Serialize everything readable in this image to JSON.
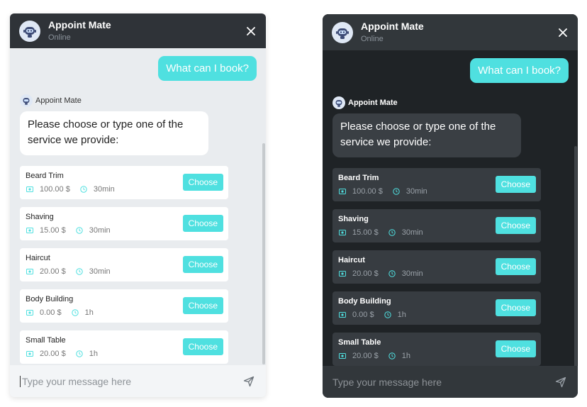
{
  "light": {
    "header": {
      "title": "Appoint Mate",
      "status": "Online",
      "close_icon": "close-icon"
    },
    "user_message": "What can I book?",
    "bot": {
      "name": "Appoint Mate",
      "message": "Please choose or type one of the service we provide:"
    },
    "services": [
      {
        "name": "Beard Trim",
        "price": "100.00 $",
        "duration": "30min",
        "button": "Choose"
      },
      {
        "name": "Shaving",
        "price": "15.00 $",
        "duration": "30min",
        "button": "Choose"
      },
      {
        "name": "Haircut",
        "price": "20.00 $",
        "duration": "30min",
        "button": "Choose"
      },
      {
        "name": "Body Building",
        "price": "0.00 $",
        "duration": "1h",
        "button": "Choose"
      },
      {
        "name": "Small Table",
        "price": "20.00 $",
        "duration": "1h",
        "button": "Choose"
      }
    ],
    "input": {
      "placeholder": "Type your message here",
      "send_icon": "send-icon"
    }
  },
  "dark": {
    "header": {
      "title": "Appoint Mate",
      "status": "Online",
      "close_icon": "close-icon"
    },
    "user_message": "What can I book?",
    "bot": {
      "name": "Appoint Mate",
      "message": "Please choose or type one of the service we provide:"
    },
    "services": [
      {
        "name": "Beard Trim",
        "price": "100.00 $",
        "duration": "30min",
        "button": "Choose"
      },
      {
        "name": "Shaving",
        "price": "15.00 $",
        "duration": "30min",
        "button": "Choose"
      },
      {
        "name": "Haircut",
        "price": "20.00 $",
        "duration": "30min",
        "button": "Choose"
      },
      {
        "name": "Body Building",
        "price": "0.00 $",
        "duration": "1h",
        "button": "Choose"
      },
      {
        "name": "Small Table",
        "price": "20.00 $",
        "duration": "1h",
        "button": "Choose"
      }
    ],
    "input": {
      "placeholder": "Type your message here",
      "send_icon": "send-icon"
    }
  },
  "colors": {
    "accent": "#4fe0e0",
    "header_bg": "#2f3338",
    "light_bg": "#e9ecef",
    "dark_bg": "#1f2326"
  }
}
